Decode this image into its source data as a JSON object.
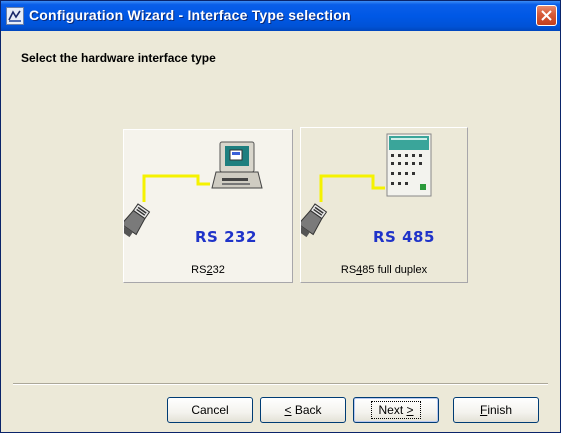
{
  "window": {
    "title": "Configuration Wizard - Interface Type selection"
  },
  "page": {
    "heading": "Select the hardware interface type"
  },
  "options": [
    {
      "code": "RS 232",
      "label_pre": "RS",
      "label_accel": "2",
      "label_post": "32",
      "icon": "computer-cable-icon",
      "selected": true
    },
    {
      "code": "RS 485",
      "label_pre": "RS",
      "label_accel": "4",
      "label_post": "85 full duplex",
      "icon": "plc-cable-icon",
      "selected": false
    }
  ],
  "buttons": {
    "cancel": "Cancel",
    "back": {
      "accel": "<",
      "text": " Back"
    },
    "next": {
      "text": "Next ",
      "accel": ">"
    },
    "finish": {
      "accel": "F",
      "text": "inish"
    }
  },
  "colors": {
    "titlebar": "#0058e6",
    "background": "#ece9d8",
    "close": "#d85d3b",
    "rs_code": "#1f33c9",
    "cable": "#f5f200"
  }
}
